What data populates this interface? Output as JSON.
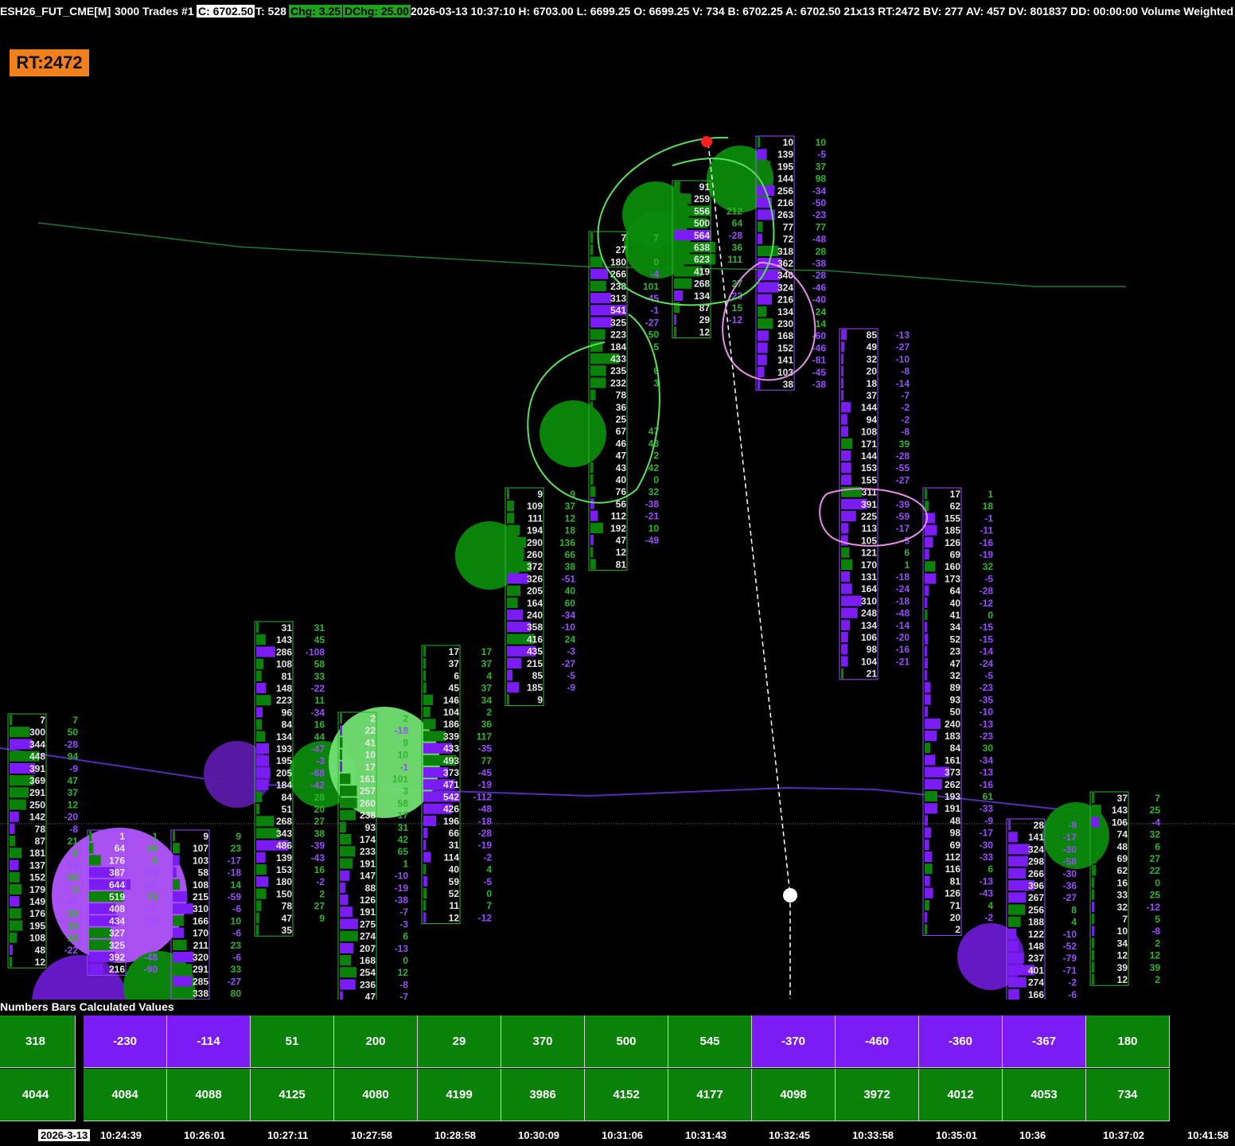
{
  "header": {
    "symbol": "ESH26_FUT_CME[M]",
    "bar_type": "3000 Trades #1",
    "close": "C: 6702.50",
    "trades": "T: 528",
    "chg": "Chg: 3.25",
    "dchg": "DChg: 25.00",
    "info": "2026-03-13 10:37:10 H: 6703.00 L: 6699.25 O: 6699.25 V: 734 B: 6702.25 A: 6702.50 21x13 RT:2472 BV: 277 AV: 457 DV: 801837 DD: 00:00:00 Volume Weighted"
  },
  "rt_badge": "RT:2472",
  "colors": {
    "green": "#0a820a",
    "purple": "#7c1cf4",
    "badge": "#f17f1b",
    "annotation_green": "#5be05b",
    "annotation_pink": "#e58fe6"
  },
  "study_title": "Numbers Bars Calculated Values",
  "table": {
    "delta_row": [
      "318",
      "-230",
      "-114",
      "51",
      "200",
      "29",
      "370",
      "500",
      "545",
      "-370",
      "-460",
      "-360",
      "-367",
      "180"
    ],
    "volume_row": [
      "4044",
      "4084",
      "4088",
      "4125",
      "4080",
      "4199",
      "3986",
      "4152",
      "4177",
      "4098",
      "3972",
      "4012",
      "4053",
      "734"
    ]
  },
  "time_axis": [
    "2026-3-13",
    "10:24:39",
    "10:26:01",
    "10:27:11",
    "10:27:58",
    "10:28:58",
    "10:30:09",
    "10:31:06",
    "10:31:43",
    "10:32:45",
    "10:33:58",
    "10:35:01",
    "10:36",
    "10:37:02",
    "10:41:58"
  ],
  "columns": [
    {
      "vol": [
        "7",
        "300",
        "344",
        "448",
        "391",
        "369",
        "291",
        "250",
        "142",
        "78",
        "87",
        "181",
        "137",
        "152",
        "179",
        "149",
        "176",
        "195",
        "108",
        "48",
        "12"
      ],
      "delta": [
        "7",
        "50",
        "-28",
        "94",
        "-9",
        "47",
        "37",
        "12",
        "-20",
        "-8",
        "21",
        "8",
        "-19",
        "40",
        "3",
        "-23",
        "26",
        "19",
        "18",
        "-22",
        ""
      ]
    },
    {
      "vol": [
        "1",
        "64",
        "176",
        "387",
        "644",
        "519",
        "408",
        "434",
        "327",
        "325",
        "392",
        "216"
      ],
      "delta": [
        "1",
        "18",
        "0",
        "-11",
        "-46",
        "73",
        "-30",
        "-26",
        "",
        "",
        "-48",
        "-90"
      ]
    },
    {
      "vol": [
        "9",
        "107",
        "103",
        "58",
        "108",
        "215",
        "310",
        "166",
        "170",
        "211",
        "320",
        "291",
        "285",
        "338"
      ],
      "delta": [
        "9",
        "23",
        "-17",
        "-18",
        "14",
        "-59",
        "-6",
        "10",
        "-6",
        "23",
        "-6",
        "33",
        "-27",
        "80"
      ]
    },
    {
      "vol": [
        "31",
        "143",
        "286",
        "108",
        "81",
        "148",
        "223",
        "96",
        "84",
        "134",
        "193",
        "195",
        "205",
        "184",
        "84",
        "51",
        "268",
        "343",
        "486",
        "139",
        "153",
        "180",
        "150",
        "78",
        "47",
        "35"
      ],
      "delta": [
        "31",
        "45",
        "-108",
        "58",
        "33",
        "-22",
        "11",
        "-34",
        "16",
        "44",
        "-47",
        "-3",
        "-68",
        "-42",
        "28",
        "20",
        "27",
        "38",
        "-39",
        "-43",
        "16",
        "-2",
        "2",
        "27",
        "9",
        ""
      ]
    },
    {
      "vol": [
        "2",
        "22",
        "41",
        "10",
        "17",
        "161",
        "257",
        "260",
        "238",
        "93",
        "174",
        "233",
        "191",
        "147",
        "88",
        "126",
        "191",
        "275",
        "274",
        "207",
        "168",
        "254",
        "236",
        "47"
      ],
      "delta": [
        "2",
        "-18",
        "9",
        "10",
        "-1",
        "101",
        "3",
        "58",
        "17",
        "31",
        "42",
        "65",
        "1",
        "-10",
        "-19",
        "-38",
        "-7",
        "-3",
        "6",
        "-13",
        "0",
        "12",
        "-8",
        "-7"
      ]
    },
    {
      "vol": [
        "17",
        "37",
        "6",
        "45",
        "146",
        "104",
        "186",
        "339",
        "433",
        "493",
        "373",
        "471",
        "542",
        "426",
        "196",
        "66",
        "31",
        "114",
        "40",
        "59",
        "52",
        "11",
        "12"
      ],
      "delta": [
        "17",
        "37",
        "4",
        "37",
        "34",
        "2",
        "36",
        "117",
        "-35",
        "77",
        "-45",
        "-19",
        "-112",
        "-48",
        "-18",
        "-28",
        "-19",
        "-2",
        "4",
        "-5",
        "0",
        "7",
        "-12"
      ]
    },
    {
      "vol": [
        "9",
        "109",
        "111",
        "194",
        "290",
        "260",
        "372",
        "326",
        "205",
        "164",
        "240",
        "358",
        "416",
        "435",
        "215",
        "85",
        "185",
        "9"
      ],
      "delta": [
        "9",
        "37",
        "12",
        "18",
        "136",
        "66",
        "38",
        "-51",
        "40",
        "60",
        "-34",
        "-10",
        "24",
        "-3",
        "-27",
        "-5",
        "-9",
        ""
      ]
    },
    {
      "vol": [
        "7",
        "27",
        "180",
        "266",
        "238",
        "313",
        "541",
        "325",
        "223",
        "184",
        "433",
        "235",
        "232",
        "78",
        "36",
        "25",
        "67",
        "46",
        "47",
        "43",
        "40",
        "76",
        "56",
        "112",
        "192",
        "47",
        "12",
        "81"
      ],
      "delta": [
        "7",
        "",
        "0",
        "-4",
        "101",
        "-45",
        "-1",
        "-27",
        "50",
        "5",
        "",
        "6",
        "3",
        "",
        "",
        "",
        "47",
        "43",
        "2",
        "42",
        "0",
        "32",
        "-38",
        "-21",
        "10",
        "-49",
        "",
        ""
      ]
    },
    {
      "vol": [
        "91",
        "259",
        "556",
        "500",
        "564",
        "638",
        "623",
        "419",
        "268",
        "134",
        "87",
        "29",
        "12"
      ],
      "delta": [
        "",
        "",
        "212",
        "64",
        "-28",
        "36",
        "111",
        "",
        "27",
        "-23",
        "15",
        "-12",
        ""
      ]
    },
    {
      "vol": [
        "10",
        "139",
        "195",
        "144",
        "256",
        "216",
        "263",
        "77",
        "72",
        "318",
        "362",
        "340",
        "324",
        "216",
        "134",
        "230",
        "168",
        "152",
        "141",
        "103",
        "38"
      ],
      "delta": [
        "10",
        "-5",
        "37",
        "98",
        "-34",
        "-50",
        "-23",
        "77",
        "-48",
        "28",
        "-38",
        "-28",
        "-46",
        "-40",
        "24",
        "14",
        "-60",
        "-46",
        "-81",
        "-45",
        "-38"
      ]
    },
    {
      "vol": [
        "85",
        "49",
        "32",
        "20",
        "18",
        "37",
        "144",
        "94",
        "108",
        "171",
        "144",
        "153",
        "155",
        "311",
        "391",
        "225",
        "113",
        "105",
        "121",
        "170",
        "131",
        "164",
        "310",
        "248",
        "134",
        "106",
        "98",
        "104",
        "21"
      ],
      "delta": [
        "-13",
        "-27",
        "-10",
        "-8",
        "-14",
        "-7",
        "-2",
        "-2",
        "-8",
        "39",
        "-28",
        "-55",
        "-27",
        "",
        "-39",
        "-59",
        "-17",
        "-5",
        "6",
        "1",
        "-18",
        "-24",
        "-18",
        "-48",
        "-14",
        "-20",
        "-16",
        "-21",
        ""
      ]
    },
    {
      "vol": [
        "17",
        "62",
        "155",
        "185",
        "126",
        "69",
        "160",
        "173",
        "64",
        "40",
        "41",
        "34",
        "52",
        "23",
        "47",
        "32",
        "89",
        "93",
        "50",
        "240",
        "183",
        "84",
        "161",
        "373",
        "262",
        "193",
        "191",
        "48",
        "98",
        "69",
        "112",
        "116",
        "81",
        "126",
        "71",
        "20",
        "2"
      ],
      "delta": [
        "1",
        "18",
        "-1",
        "-11",
        "-16",
        "-19",
        "32",
        "-5",
        "-28",
        "-12",
        "0",
        "-15",
        "-15",
        "-14",
        "-24",
        "-5",
        "-23",
        "-35",
        "-10",
        "-13",
        "-23",
        "30",
        "-34",
        "-13",
        "-16",
        "61",
        "-33",
        "-9",
        "-17",
        "-30",
        "-33",
        "6",
        "-13",
        "-43",
        "4",
        "-2",
        ""
      ]
    },
    {
      "vol": [
        "28",
        "141",
        "324",
        "298",
        "266",
        "396",
        "267",
        "256",
        "188",
        "122",
        "148",
        "237",
        "401",
        "274",
        "166"
      ],
      "delta": [
        "-9",
        "-17",
        "-30",
        "-58",
        "-30",
        "-36",
        "-27",
        "8",
        "4",
        "-10",
        "-52",
        "-79",
        "-71",
        "-2",
        "-6"
      ]
    },
    {
      "vol": [
        "37",
        "143",
        "106",
        "74",
        "48",
        "69",
        "62",
        "16",
        "33",
        "32",
        "7",
        "10",
        "34",
        "12",
        "39",
        "12"
      ],
      "delta": [
        "7",
        "25",
        "-4",
        "32",
        "6",
        "27",
        "22",
        "0",
        "25",
        "-12",
        "5",
        "-8",
        "2",
        "12",
        "39",
        "2"
      ]
    }
  ]
}
